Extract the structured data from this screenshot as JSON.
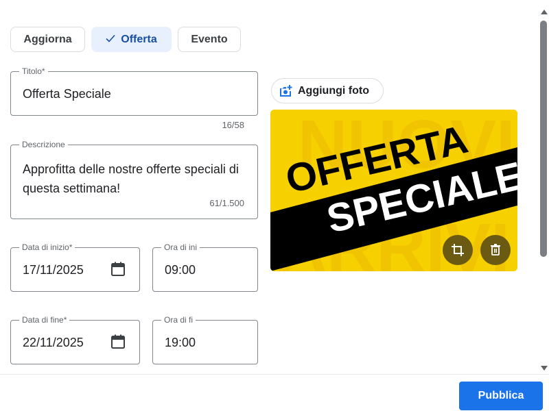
{
  "post_types": {
    "update_label": "Aggiorna",
    "offer_label": "Offerta",
    "event_label": "Evento",
    "selected": "Offerta"
  },
  "title_field": {
    "label": "Titolo*",
    "value": "Offerta Speciale",
    "counter": "16/58"
  },
  "description_field": {
    "label": "Descrizione",
    "value": "Approfitta delle nostre offerte speciali di questa settimana!",
    "counter": "61/1.500"
  },
  "start": {
    "date_label": "Data di inizio*",
    "date_value": "17/11/2025",
    "time_label": "Ora di ini",
    "time_value": "09:00"
  },
  "end": {
    "date_label": "Data di fine*",
    "date_value": "22/11/2025",
    "time_label": "Ora di fi",
    "time_value": "19:00"
  },
  "photo": {
    "add_label": "Aggiungi foto",
    "image_text_top": "OFFERTA",
    "image_text_bottom": "SPECIALE",
    "image_bg_text_top": "NUOVI",
    "image_bg_text_bottom": "ARRIVI"
  },
  "footer": {
    "publish_label": "Pubblica"
  },
  "colors": {
    "accent": "#1a73e8",
    "chip_selected_bg": "#e8f0fe",
    "image_yellow": "#f7d000",
    "image_black": "#000000",
    "image_button": "#6b5a12"
  },
  "icons": {
    "offer_chip": "check-icon",
    "date_picker": "calendar-icon",
    "add_photo": "add-photo-icon",
    "crop": "crop-icon",
    "delete": "trash-icon"
  }
}
